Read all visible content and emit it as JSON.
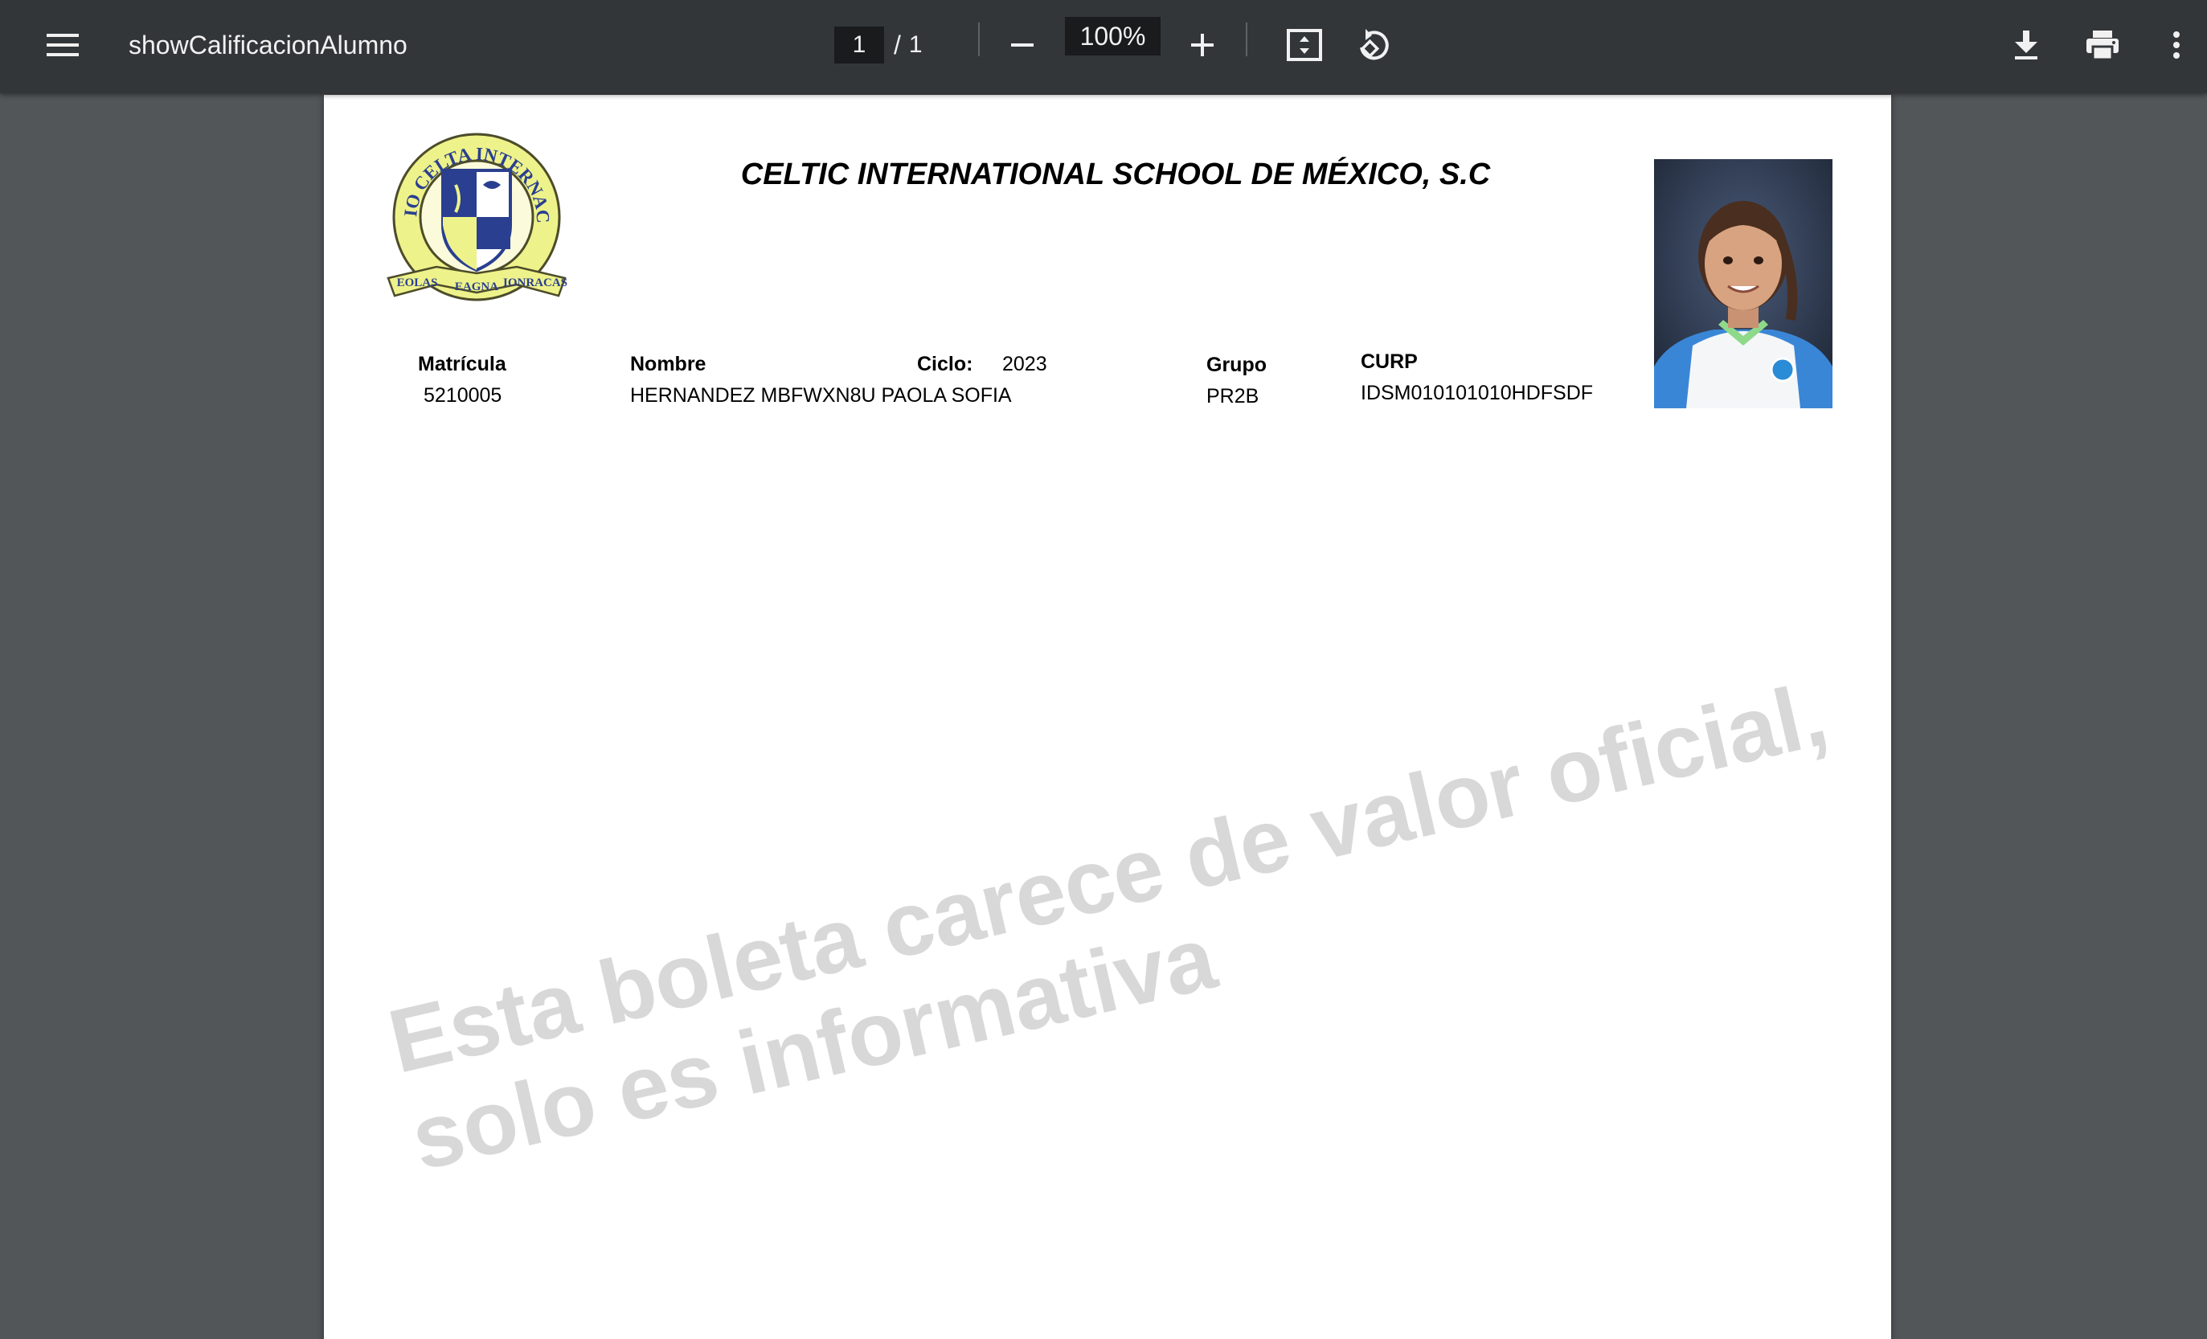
{
  "toolbar": {
    "title": "showCalificacionAlumno",
    "current_page": "1",
    "page_separator": "/",
    "total_pages": "1",
    "zoom": "100%",
    "icons": {
      "menu": "menu-icon",
      "zoom_out": "minus-icon",
      "zoom_in": "plus-icon",
      "fit": "fit-page-icon",
      "rotate": "rotate-icon",
      "download": "download-icon",
      "print": "print-icon",
      "more": "more-vert-icon"
    }
  },
  "document": {
    "school_name": "CELTIC INTERNATIONAL SCHOOL DE MÉXICO, S.C",
    "logo": {
      "ring_text": "COLEGIO CELTA INTERNACIONAL",
      "motto": [
        "EOLAS",
        "EAGNA",
        "IONRACAS"
      ]
    },
    "fields": {
      "matricula_label": "Matrícula",
      "matricula_value": "5210005",
      "nombre_label": "Nombre",
      "nombre_value": "HERNANDEZ MBFWXN8U PAOLA SOFIA",
      "ciclo_label": "Ciclo:",
      "ciclo_value": "2023",
      "grupo_label": "Grupo",
      "grupo_value": "PR2B",
      "curp_label": "CURP",
      "curp_value": "IDSM010101010HDFSDF"
    },
    "watermark": {
      "line1": "Esta boleta carece de valor oficial,",
      "line2": "solo es informativa"
    }
  },
  "colors": {
    "toolbar_bg": "#323639",
    "viewer_bg": "#525659",
    "page_bg": "#ffffff",
    "watermark": "#d8d8d8",
    "logo_yellow": "#eef28a",
    "logo_blue": "#2a3f8f"
  }
}
